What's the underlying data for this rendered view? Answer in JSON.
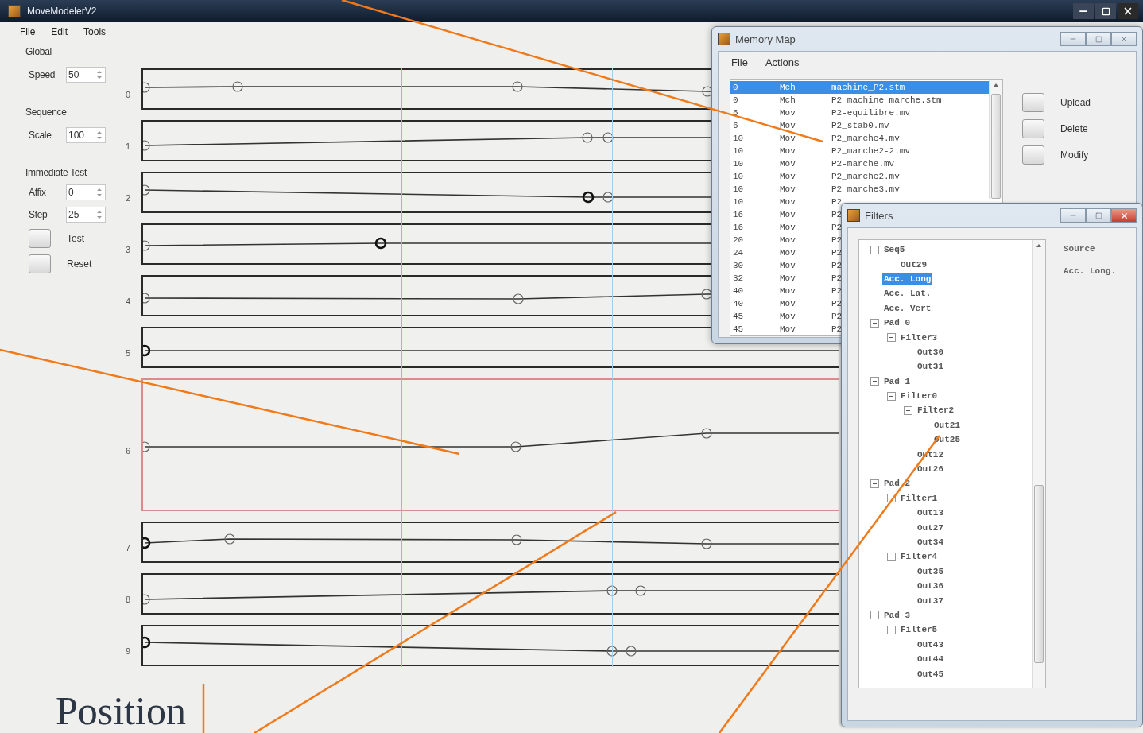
{
  "window": {
    "title": "MoveModelerV2"
  },
  "menu": [
    "File",
    "Edit",
    "Tools"
  ],
  "panel": {
    "groups": [
      {
        "title": "Global",
        "fields": [
          {
            "label": "Speed",
            "value": "50"
          }
        ]
      },
      {
        "title": "Sequence",
        "fields": [
          {
            "label": "Scale",
            "value": "100"
          }
        ]
      },
      {
        "title": "Immediate Test",
        "fields": [
          {
            "label": "Affix",
            "value": "0"
          },
          {
            "label": "Step",
            "value": "25"
          }
        ],
        "buttons": [
          "Test",
          "Reset"
        ]
      }
    ]
  },
  "tracks": [
    {
      "label": "0",
      "selected": false
    },
    {
      "label": "1",
      "selected": false
    },
    {
      "label": "2",
      "selected": false
    },
    {
      "label": "3",
      "selected": false
    },
    {
      "label": "4",
      "selected": false
    },
    {
      "label": "5",
      "selected": false
    },
    {
      "label": "6",
      "selected": true
    },
    {
      "label": "7",
      "selected": false
    },
    {
      "label": "8",
      "selected": false
    },
    {
      "label": "9",
      "selected": false
    }
  ],
  "memory_map": {
    "title": "Memory Map",
    "menu": [
      "File",
      "Actions"
    ],
    "rows": [
      {
        "column_1": "0",
        "column_2": "Mch",
        "column_3": "machine_P2.stm",
        "selected": true
      },
      {
        "column_1": "0",
        "column_2": "Mch",
        "column_3": "P2_machine_marche.stm",
        "selected": false
      },
      {
        "column_1": "6",
        "column_2": "Mov",
        "column_3": "P2-equilibre.mv",
        "selected": false
      },
      {
        "column_1": "6",
        "column_2": "Mov",
        "column_3": "P2_stab0.mv",
        "selected": false
      },
      {
        "column_1": "10",
        "column_2": "Mov",
        "column_3": "P2_marche4.mv",
        "selected": false
      },
      {
        "column_1": "10",
        "column_2": "Mov",
        "column_3": "P2_marche2-2.mv",
        "selected": false
      },
      {
        "column_1": "10",
        "column_2": "Mov",
        "column_3": "P2-marche.mv",
        "selected": false
      },
      {
        "column_1": "10",
        "column_2": "Mov",
        "column_3": "P2_marche2.mv",
        "selected": false
      },
      {
        "column_1": "10",
        "column_2": "Mov",
        "column_3": "P2_marche3.mv",
        "selected": false
      },
      {
        "column_1": "10",
        "column_2": "Mov",
        "column_3": "P2",
        "selected": false
      },
      {
        "column_1": "16",
        "column_2": "Mov",
        "column_3": "P2",
        "selected": false
      },
      {
        "column_1": "16",
        "column_2": "Mov",
        "column_3": "P2",
        "selected": false
      },
      {
        "column_1": "20",
        "column_2": "Mov",
        "column_3": "P2",
        "selected": false
      },
      {
        "column_1": "24",
        "column_2": "Mov",
        "column_3": "P2",
        "selected": false
      },
      {
        "column_1": "30",
        "column_2": "Mov",
        "column_3": "P2",
        "selected": false
      },
      {
        "column_1": "32",
        "column_2": "Mov",
        "column_3": "P2",
        "selected": false
      },
      {
        "column_1": "40",
        "column_2": "Mov",
        "column_3": "P2",
        "selected": false
      },
      {
        "column_1": "40",
        "column_2": "Mov",
        "column_3": "P2",
        "selected": false
      },
      {
        "column_1": "45",
        "column_2": "Mov",
        "column_3": "P2",
        "selected": false
      },
      {
        "column_1": "45",
        "column_2": "Mov",
        "column_3": "P2",
        "selected": false
      }
    ],
    "buttons": [
      "Upload",
      "Delete",
      "Modify"
    ]
  },
  "filters": {
    "title": "Filters",
    "tree": [
      {
        "label": "Seq5",
        "selected": false,
        "expanded": true,
        "children": [
          {
            "label": "Out29",
            "selected": false
          }
        ]
      },
      {
        "label": "Acc. Long",
        "selected": true
      },
      {
        "label": "Acc. Lat.",
        "selected": false
      },
      {
        "label": "Acc. Vert",
        "selected": false
      },
      {
        "label": "Pad 0",
        "selected": false,
        "expanded": true,
        "children": [
          {
            "label": "Filter3",
            "selected": false,
            "expanded": true,
            "children": [
              {
                "label": "Out30",
                "selected": false
              },
              {
                "label": "Out31",
                "selected": false
              }
            ]
          }
        ]
      },
      {
        "label": "Pad 1",
        "selected": false,
        "expanded": true,
        "children": [
          {
            "label": "Filter0",
            "selected": false,
            "expanded": true,
            "children": [
              {
                "label": "Filter2",
                "selected": false,
                "expanded": true,
                "children": [
                  {
                    "label": "Out21",
                    "selected": false
                  },
                  {
                    "label": "Out25",
                    "selected": false
                  }
                ]
              },
              {
                "label": "Out12",
                "selected": false
              },
              {
                "label": "Out26",
                "selected": false
              }
            ]
          }
        ]
      },
      {
        "label": "Pad 2",
        "selected": false,
        "expanded": true,
        "children": [
          {
            "label": "Filter1",
            "selected": false,
            "expanded": true,
            "children": [
              {
                "label": "Out13",
                "selected": false
              },
              {
                "label": "Out27",
                "selected": false
              },
              {
                "label": "Out34",
                "selected": false
              }
            ]
          },
          {
            "label": "Filter4",
            "selected": false,
            "expanded": true,
            "children": [
              {
                "label": "Out35",
                "selected": false
              },
              {
                "label": "Out36",
                "selected": false
              },
              {
                "label": "Out37",
                "selected": false
              }
            ]
          }
        ]
      },
      {
        "label": "Pad 3",
        "selected": false,
        "expanded": true,
        "children": [
          {
            "label": "Filter5",
            "selected": false,
            "expanded": true,
            "children": [
              {
                "label": "Out43",
                "selected": false
              },
              {
                "label": "Out44",
                "selected": false
              },
              {
                "label": "Out45",
                "selected": false
              }
            ]
          }
        ]
      }
    ],
    "source_label": "Source",
    "source_value": "Acc. Long."
  },
  "caption": "Position"
}
